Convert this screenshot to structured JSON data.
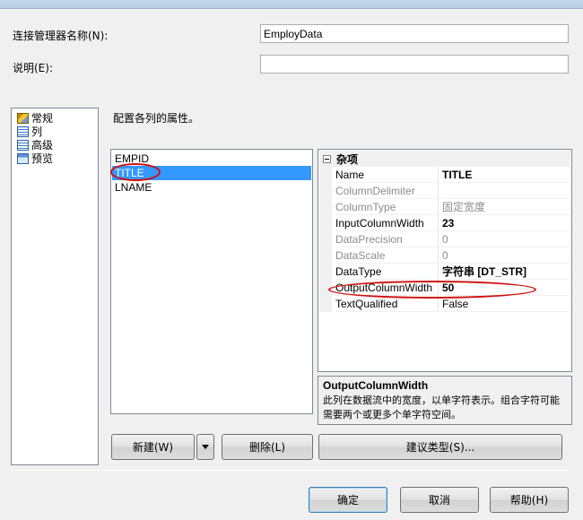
{
  "form": {
    "conn_name_label": "连接管理器名称(N):",
    "conn_name_value": "EmployData",
    "description_label": "说明(E):",
    "description_value": ""
  },
  "nav": {
    "items": [
      {
        "label": "常规",
        "icon": "general-settings-icon"
      },
      {
        "label": "列",
        "icon": "columns-grid-icon"
      },
      {
        "label": "高级",
        "icon": "advanced-grid-icon"
      },
      {
        "label": "预览",
        "icon": "preview-icon"
      }
    ],
    "selected": "高级"
  },
  "main": {
    "instruction": "配置各列的属性。",
    "columns": [
      "EMPID",
      "TITLE",
      "LNAME"
    ],
    "selected_column": "TITLE"
  },
  "properties": {
    "category": "杂项",
    "rows": [
      {
        "name": "Name",
        "value": "TITLE"
      },
      {
        "name": "ColumnDelimiter",
        "value": ""
      },
      {
        "name": "ColumnType",
        "value": "固定宽度"
      },
      {
        "name": "InputColumnWidth",
        "value": "23"
      },
      {
        "name": "DataPrecision",
        "value": "0"
      },
      {
        "name": "DataScale",
        "value": "0"
      },
      {
        "name": "DataType",
        "value": "字符串 [DT_STR]"
      },
      {
        "name": "OutputColumnWidth",
        "value": "50"
      },
      {
        "name": "TextQualified",
        "value": "False"
      }
    ]
  },
  "description_panel": {
    "title": "OutputColumnWidth",
    "text": "此列在数据流中的宽度，以单字符表示。组合字符可能需要两个或更多个单字符空间。"
  },
  "buttons": {
    "new": "新建(W)",
    "delete": "删除(L)",
    "suggest": "建议类型(S)...",
    "ok": "确定",
    "cancel": "取消",
    "help": "帮助(H)"
  },
  "colors": {
    "selection": "#3399ff",
    "annotation": "#d01010"
  }
}
